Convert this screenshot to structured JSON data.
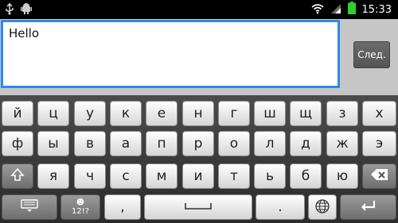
{
  "status_bar": {
    "time": "15:33"
  },
  "editor": {
    "text_value": "Hello"
  },
  "action_button": {
    "label": "След."
  },
  "keyboard": {
    "row1": [
      "й",
      "ц",
      "у",
      "к",
      "е",
      "н",
      "г",
      "ш",
      "щ",
      "з",
      "х"
    ],
    "row2": [
      "ф",
      "ы",
      "в",
      "а",
      "п",
      "р",
      "о",
      "л",
      "д",
      "ж",
      "э"
    ],
    "row3": [
      "я",
      "ч",
      "с",
      "м",
      "и",
      "т",
      "ь",
      "б",
      "ю"
    ],
    "symbols_label": "12!?",
    "symbols_emoji": "☻",
    "comma": ",",
    "period": "."
  }
}
